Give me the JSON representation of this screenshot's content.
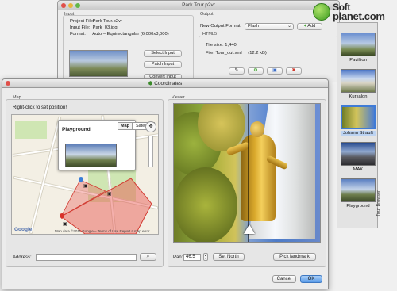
{
  "main_window": {
    "title": "Park Tour.p2vr",
    "input_section": "Input",
    "output_section": "Output",
    "project_file_key": "Project File:",
    "project_file_val": "Park Tour.p2vr",
    "input_file_key": "Input File:",
    "input_file_val": "Park_03.jpg",
    "format_key": "Format:",
    "format_val": "Auto – Equirectangular (6,000x3,000)",
    "select_input": "Select Input",
    "patch_input": "Patch Input",
    "convert_input": "Convert Input",
    "new_output_format_label": "New Output Format:",
    "output_format": "Flash",
    "add_button": "Add",
    "html5_label": "HTML5",
    "tile_size": "Tile size: 1,440",
    "file_label": "File: Tour_out.xml",
    "file_size": "(12.2 kB)"
  },
  "gallery": {
    "items": [
      {
        "caption": "Pavillion",
        "selected": false
      },
      {
        "caption": "Kursalon",
        "selected": false
      },
      {
        "caption": "Johann Strauß",
        "selected": true
      },
      {
        "caption": "MAK",
        "selected": false
      },
      {
        "caption": "Playground",
        "selected": false
      }
    ],
    "side_text": "Tour Browser"
  },
  "watermark": {
    "line1": "Soft",
    "line2": "planet.com"
  },
  "dialog": {
    "title": "Coordinates",
    "hint": "Right-click to set position!",
    "map_label": "Map",
    "viewer_label": "Viewer",
    "popup_title": "Playground",
    "map_tab": "Map",
    "satellite_tab": "Satellite",
    "google": "Google",
    "map_footer": "Map data ©2011 Google – Terms of Use   Report a map error",
    "address_label": "Address:",
    "address_value": "",
    "pan_label": "Pan:",
    "pan_value": "46.5",
    "set_north": "Set North",
    "pick_landmark": "Pick landmark",
    "cancel": "Cancel",
    "ok": "OK"
  },
  "colors": {
    "accent": "#5b9ce8",
    "polygon": "#e8504a",
    "selection": "#3f7bd6"
  }
}
